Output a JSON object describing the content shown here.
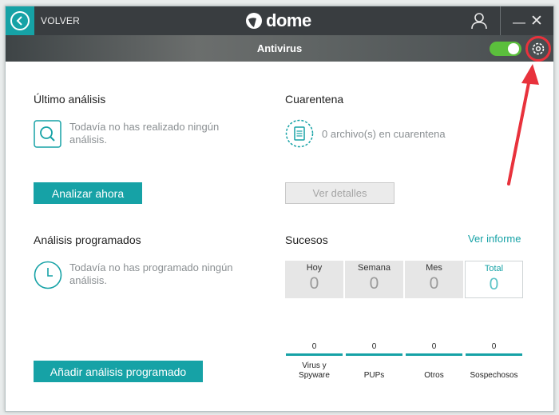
{
  "titlebar": {
    "back_label": "VOLVER",
    "brand_name": "dome"
  },
  "header": {
    "title": "Antivirus",
    "protection_toggle_on": true
  },
  "last_scan": {
    "title": "Último análisis",
    "message": "Todavía no has realizado ningún análisis.",
    "button_label": "Analizar ahora"
  },
  "quarantine": {
    "title": "Cuarentena",
    "message": "0 archivo(s) en cuarentena",
    "button_label": "Ver detalles"
  },
  "scheduled": {
    "title": "Análisis programados",
    "message": "Todavía no has programado ningún análisis.",
    "button_label": "Añadir análisis programado"
  },
  "events": {
    "title": "Sucesos",
    "report_link": "Ver informe",
    "periods": [
      {
        "label": "Hoy",
        "value": "0"
      },
      {
        "label": "Semana",
        "value": "0"
      },
      {
        "label": "Mes",
        "value": "0"
      },
      {
        "label": "Total",
        "value": "0"
      }
    ],
    "categories": [
      {
        "count": "0",
        "label": "Virus y Spyware"
      },
      {
        "count": "0",
        "label": "PUPs"
      },
      {
        "count": "0",
        "label": "Otros"
      },
      {
        "count": "0",
        "label": "Sospechosos"
      }
    ]
  },
  "colors": {
    "accent": "#16a2a6",
    "titlebar": "#393d40",
    "toggle_on": "#5bbf3c",
    "annotation": "#e8323c"
  }
}
